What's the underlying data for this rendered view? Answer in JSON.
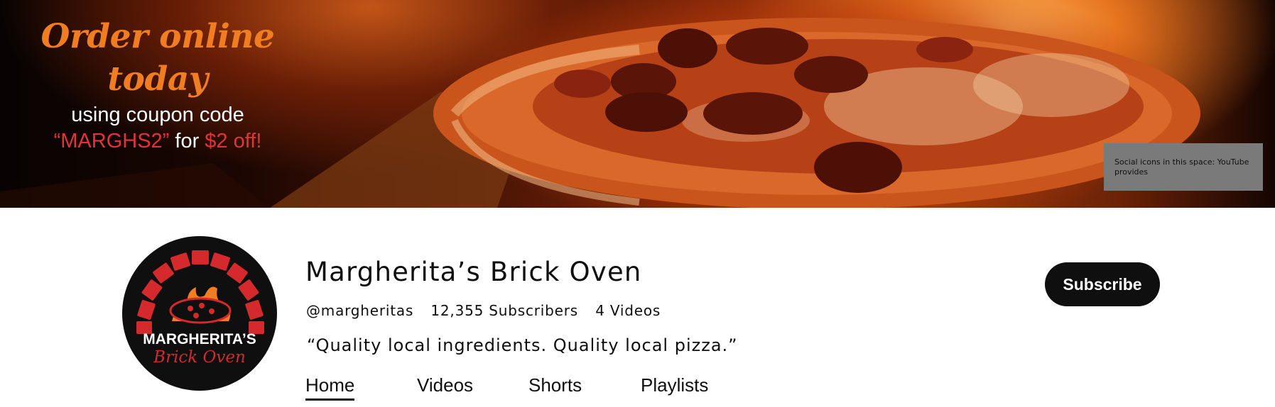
{
  "banner": {
    "promo_headline": "Order online today",
    "promo_line2": "using coupon code",
    "promo_code": "“MARGHS2”",
    "promo_for": "for",
    "promo_off": "$2 off!",
    "social_placeholder": "Social icons in this space: YouTube provides"
  },
  "channel": {
    "name": "Margherita’s Brick Oven",
    "handle": "@margheritas",
    "subscribers": "12,355 Subscribers",
    "videos": "4 Videos",
    "tagline": "“Quality local ingredients. Quality local pizza.”",
    "logo_line1": "MARGHERITA’S",
    "logo_line2": "Brick Oven"
  },
  "subscribe_label": "Subscribe",
  "tabs": [
    {
      "label": "Home",
      "active": true
    },
    {
      "label": "Videos",
      "active": false
    },
    {
      "label": "Shorts",
      "active": false
    },
    {
      "label": "Playlists",
      "active": false
    }
  ],
  "colors": {
    "promo_orange": "#f07d22",
    "promo_red": "#e0343a",
    "logo_red": "#d42a2e",
    "subscribe_bg": "#0f0f0f"
  }
}
